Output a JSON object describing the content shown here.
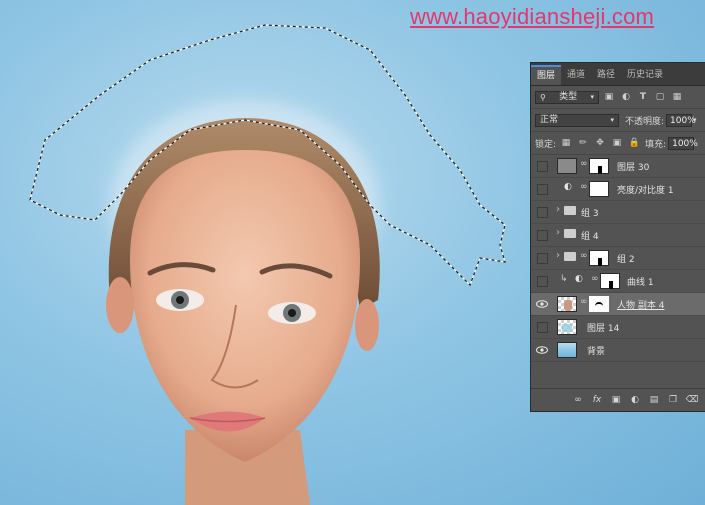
{
  "watermark": "www.haoyidiansheji.com",
  "panel": {
    "tabs": [
      {
        "label": "图层",
        "active": true
      },
      {
        "label": "通道",
        "active": false
      },
      {
        "label": "路径",
        "active": false
      },
      {
        "label": "历史记录",
        "active": false
      }
    ],
    "filter_kind": "类型",
    "blend_mode": "正常",
    "opacity_label": "不透明度:",
    "opacity_value": "100%",
    "lock_label": "锁定:",
    "fill_label": "填充:",
    "fill_value": "100%",
    "layers": [
      {
        "name": "图层 30",
        "visible": false,
        "selected": false
      },
      {
        "name": "亮度/对比度 1",
        "visible": false,
        "selected": false
      },
      {
        "name": "组 3",
        "visible": false,
        "selected": false
      },
      {
        "name": "组 4",
        "visible": false,
        "selected": false
      },
      {
        "name": "组 2",
        "visible": false,
        "selected": false
      },
      {
        "name": "曲线 1",
        "visible": false,
        "selected": false
      },
      {
        "name": "人物 副本 4",
        "visible": true,
        "selected": true
      },
      {
        "name": "图层 14",
        "visible": false,
        "selected": false
      },
      {
        "name": "背景",
        "visible": true,
        "selected": false
      }
    ],
    "footer_icons": [
      "link-layers-icon",
      "fx-icon",
      "add-mask-icon",
      "adjustment-icon",
      "new-group-icon",
      "new-layer-icon",
      "delete-icon"
    ]
  },
  "colors": {
    "canvas_blue": "#8fc5e4",
    "panel_bg": "#535353",
    "selected_row": "#6b6b6b",
    "watermark": "#e4376c",
    "active_tab_accent": "#4f8ddc"
  }
}
